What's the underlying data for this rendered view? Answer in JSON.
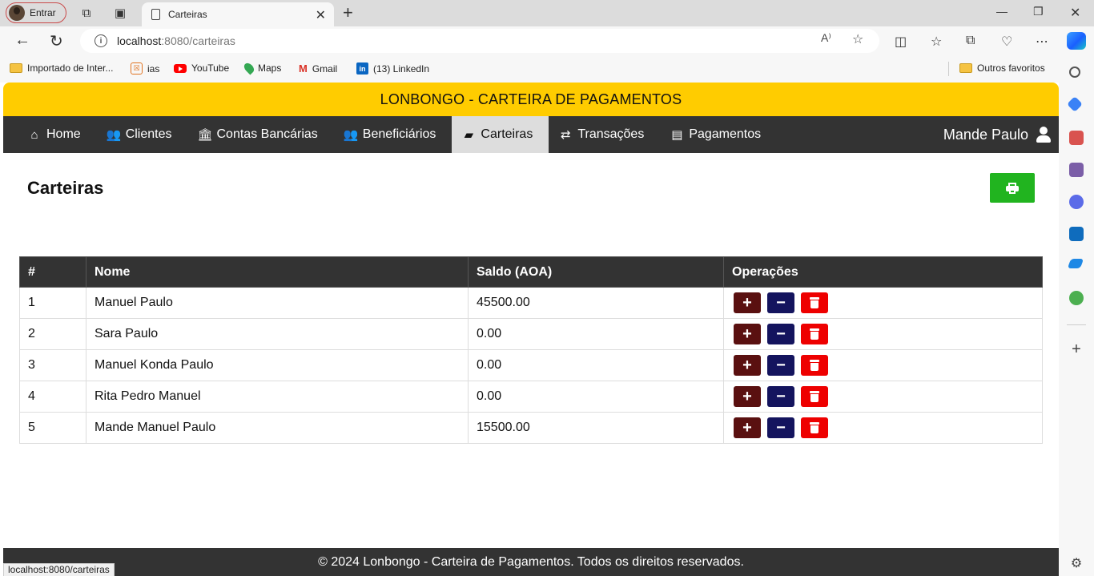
{
  "browser": {
    "profile_label": "Entrar",
    "tab_title": "Carteiras",
    "url_host": "localhost",
    "url_path": ":8080/carteiras",
    "bookmarks": [
      {
        "label": "Importado de Inter...",
        "icon": "folder-icon"
      },
      {
        "label": "ias",
        "icon": "ias-icon"
      },
      {
        "label": "YouTube",
        "icon": "youtube-icon"
      },
      {
        "label": "Maps",
        "icon": "maps-icon"
      },
      {
        "label": "Gmail",
        "icon": "gmail-icon"
      },
      {
        "label": "(13) LinkedIn",
        "icon": "linkedin-icon"
      }
    ],
    "other_favorites": "Outros favoritos",
    "status_url": "localhost:8080/carteiras"
  },
  "app": {
    "banner": "LONBONGO - CARTEIRA DE PAGAMENTOS",
    "nav": [
      {
        "label": "Home",
        "icon": "home-icon"
      },
      {
        "label": "Clientes",
        "icon": "users-icon"
      },
      {
        "label": "Contas Bancárias",
        "icon": "bank-icon"
      },
      {
        "label": "Beneficiários",
        "icon": "user-friends-icon"
      },
      {
        "label": "Carteiras",
        "icon": "wallet-icon",
        "active": true
      },
      {
        "label": "Transações",
        "icon": "exchange-icon"
      },
      {
        "label": "Pagamentos",
        "icon": "money-check-icon"
      }
    ],
    "user_name": "Mande Paulo",
    "page_title": "Carteiras",
    "table": {
      "headers": [
        "#",
        "Nome",
        "Saldo (AOA)",
        "Operações"
      ],
      "rows": [
        {
          "id": "1",
          "nome": "Manuel Paulo",
          "saldo": "45500.00"
        },
        {
          "id": "2",
          "nome": "Sara Paulo",
          "saldo": "0.00"
        },
        {
          "id": "3",
          "nome": "Manuel Konda Paulo",
          "saldo": "0.00"
        },
        {
          "id": "4",
          "nome": "Rita Pedro Manuel",
          "saldo": "0.00"
        },
        {
          "id": "5",
          "nome": "Mande Manuel Paulo",
          "saldo": "15500.00"
        }
      ]
    },
    "footer": "© 2024 Lonbongo - Carteira de Pagamentos. Todos os direitos reservados.",
    "colors": {
      "banner": "#ffcc00",
      "nav_bg": "#333333",
      "print_button": "#21b41f",
      "add_button": "#5a1010",
      "subtract_button": "#14145e",
      "delete_button": "#ee0000"
    }
  }
}
